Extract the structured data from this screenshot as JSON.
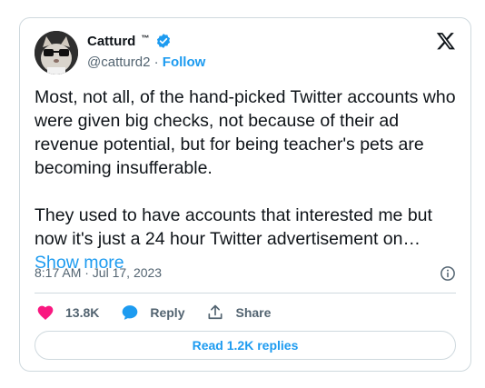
{
  "author": {
    "name": "Catturd",
    "tm": "™",
    "handle": "@catturd2",
    "separator": "·",
    "follow_label": "Follow"
  },
  "tweet": {
    "paragraph1": "Most, not all, of the hand-picked Twitter accounts who were given big checks, not because of their ad revenue potential, but for being teacher's pets are becoming insufferable.",
    "paragraph2": "They used to have accounts that interested me but now it's just a 24 hour Twitter advertisement on…",
    "show_more": "Show more",
    "timestamp": "8:17 AM · Jul 17, 2023"
  },
  "actions": {
    "likes": "13.8K",
    "reply_label": "Reply",
    "share_label": "Share"
  },
  "read_replies_label": "Read 1.2K replies",
  "colors": {
    "accent": "#1d9bf0",
    "like": "#f91880",
    "text": "#0f1419",
    "muted": "#536471",
    "border": "#cfd9de"
  }
}
